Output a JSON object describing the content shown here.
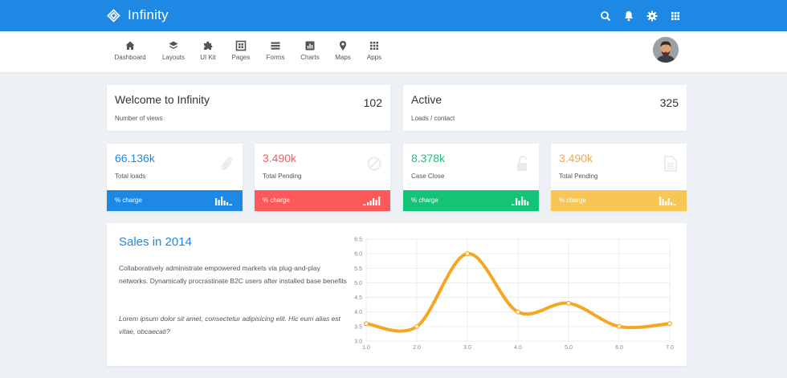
{
  "header": {
    "brand": "Infinity",
    "brand_icon": "diamond-logo-icon",
    "icons": [
      "search-icon",
      "bell-icon",
      "gear-icon",
      "apps-grid-icon"
    ],
    "color": "#1e88e5"
  },
  "nav": {
    "items": [
      {
        "label": "Dashboard",
        "icon": "home-icon"
      },
      {
        "label": "Layouts",
        "icon": "layers-icon"
      },
      {
        "label": "UI Kit",
        "icon": "puzzle-icon"
      },
      {
        "label": "Pages",
        "icon": "pages-icon"
      },
      {
        "label": "Forms",
        "icon": "list-icon"
      },
      {
        "label": "Charts",
        "icon": "chart-icon"
      },
      {
        "label": "Maps",
        "icon": "map-pin-icon"
      },
      {
        "label": "Apps",
        "icon": "apps-icon"
      }
    ]
  },
  "summary": [
    {
      "title": "Welcome to Infinity",
      "subtitle": "Number of views",
      "count": "102"
    },
    {
      "title": "Active",
      "subtitle": "Loads / contact",
      "count": "325"
    }
  ],
  "stats": [
    {
      "value": "66.136k",
      "label": "Total loads",
      "bar_label": "% charge",
      "color": "#1e88e5",
      "icon": "paperclip-icon"
    },
    {
      "value": "3.490k",
      "label": "Total Pending",
      "bar_label": "% charge",
      "color": "#fc5a5a",
      "icon": "block-icon"
    },
    {
      "value": "8.378k",
      "label": "Case Close",
      "bar_label": "% charge",
      "color": "#15c377",
      "icon": "unlock-icon"
    },
    {
      "value": "3.490k",
      "label": "Total Pending",
      "bar_label": "% charge",
      "color": "#faa64b",
      "icon": "file-icon"
    }
  ],
  "sales": {
    "title": "Sales in 2014",
    "description": "Collaboratively administrate empowered markets via plug-and-play networks. Dynamically procrastinate B2C users after installed base benefits",
    "quote": "Lorem ipsum dolor sit amet, consectetur adipisicing elit. Hic eum alias est vitae, obcaecati?"
  },
  "chart_data": {
    "type": "line",
    "x": [
      1.0,
      2.0,
      3.0,
      4.0,
      5.0,
      6.0,
      7.0
    ],
    "series": [
      {
        "values": [
          3.6,
          3.5,
          6.0,
          4.0,
          4.3,
          3.5,
          3.6
        ]
      }
    ],
    "xticks": [
      "1.0",
      "2.0",
      "3.0",
      "4.0",
      "5.0",
      "6.0",
      "7.0"
    ],
    "yticks": [
      "3.0",
      "3.5",
      "4.0",
      "4.5",
      "5.0",
      "5.5",
      "6.0",
      "6.5"
    ],
    "xlim": [
      1.0,
      7.0
    ],
    "ylim": [
      3.0,
      6.5
    ],
    "grid": true,
    "color": "#f5a623"
  }
}
